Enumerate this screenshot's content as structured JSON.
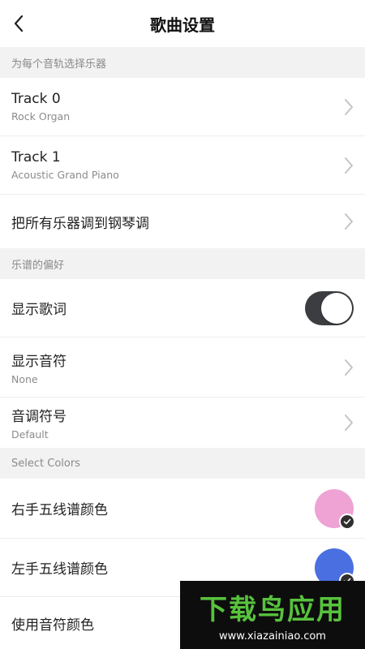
{
  "header": {
    "title": "歌曲设置"
  },
  "sections": {
    "instruments": {
      "title": "为每个音轨选择乐器"
    },
    "preferences": {
      "title": "乐谱的偏好"
    },
    "colors": {
      "title": "Select Colors"
    }
  },
  "tracks": [
    {
      "label": "Track 0",
      "sub": "Rock Organ"
    },
    {
      "label": "Track 1",
      "sub": "Acoustic Grand Piano"
    }
  ],
  "piano_all": {
    "label": "把所有乐器调到钢琴调"
  },
  "prefs": {
    "show_lyrics": {
      "label": "显示歌词",
      "enabled": true
    },
    "show_notes": {
      "label": "显示音符",
      "value": "None"
    },
    "key_signature": {
      "label": "音调符号",
      "value": "Default"
    }
  },
  "color_rows": [
    {
      "label": "右手五线谱颜色",
      "color": "#eea3d4",
      "selected": true
    },
    {
      "label": "左手五线谱颜色",
      "color": "#4a6fe0",
      "selected": true
    },
    {
      "label": "使用音符颜色"
    }
  ],
  "watermark": {
    "main": "下载鸟应用",
    "url": "www.xiazainiao.com"
  },
  "icons": {
    "back": "back-arrow-icon",
    "chevron": "chevron-right-icon",
    "check": "check-icon"
  }
}
